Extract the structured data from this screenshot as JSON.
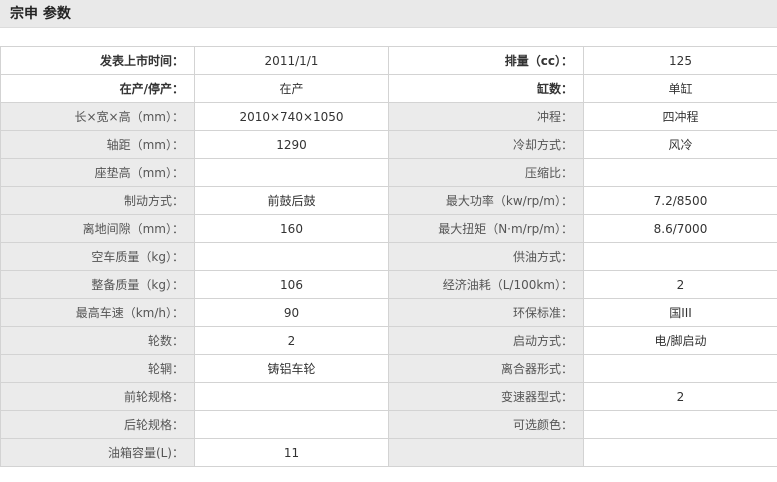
{
  "header": {
    "title": "宗申 参数"
  },
  "spec_rows": [
    {
      "left_label": "发表上市时间：",
      "left_value": "2011/1/1",
      "right_label": "排量（cc）：",
      "right_value": "125",
      "bold": true
    },
    {
      "left_label": "在产/停产：",
      "left_value": "在产",
      "right_label": "缸数：",
      "right_value": "单缸",
      "bold": true
    },
    {
      "left_label": "长×宽×高（mm）：",
      "left_value": "2010×740×1050",
      "right_label": "冲程：",
      "right_value": "四冲程",
      "bold": false
    },
    {
      "left_label": "轴距（mm）：",
      "left_value": "1290",
      "right_label": "冷却方式：",
      "right_value": "风冷",
      "bold": false
    },
    {
      "left_label": "座垫高（mm）：",
      "left_value": "",
      "right_label": "压缩比：",
      "right_value": "",
      "bold": false
    },
    {
      "left_label": "制动方式：",
      "left_value": "前鼓后鼓",
      "right_label": "最大功率（kw/rp/m）：",
      "right_value": "7.2/8500",
      "bold": false
    },
    {
      "left_label": "离地间隙（mm）：",
      "left_value": "160",
      "right_label": "最大扭矩（N·m/rp/m）：",
      "right_value": "8.6/7000",
      "bold": false
    },
    {
      "left_label": "空车质量（kg）：",
      "left_value": "",
      "right_label": "供油方式：",
      "right_value": "",
      "bold": false
    },
    {
      "left_label": "整备质量（kg）：",
      "left_value": "106",
      "right_label": "经济油耗（L/100km）：",
      "right_value": "2",
      "bold": false
    },
    {
      "left_label": "最高车速（km/h）：",
      "left_value": "90",
      "right_label": "环保标准：",
      "right_value": "国III",
      "bold": false
    },
    {
      "left_label": "轮数：",
      "left_value": "2",
      "right_label": "启动方式：",
      "right_value": "电/脚启动",
      "bold": false
    },
    {
      "left_label": "轮辋：",
      "left_value": "铸铝车轮",
      "right_label": "离合器形式：",
      "right_value": "",
      "bold": false
    },
    {
      "left_label": "前轮规格：",
      "left_value": "",
      "right_label": "变速器型式：",
      "right_value": "2",
      "bold": false
    },
    {
      "left_label": "后轮规格：",
      "left_value": "",
      "right_label": "可选颜色：",
      "right_value": "",
      "bold": false
    },
    {
      "left_label": "油箱容量(L)：",
      "left_value": "11",
      "right_label": "",
      "right_value": "",
      "bold": false
    }
  ]
}
